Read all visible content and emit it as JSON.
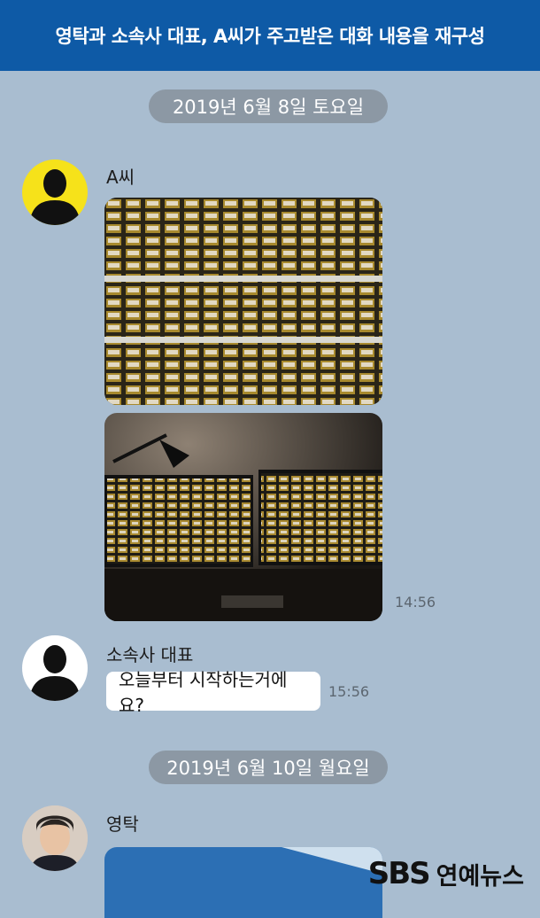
{
  "header": {
    "title": "영탁과 소속사 대표, A씨가 주고받은 대화 내용을 재구성"
  },
  "dates": [
    {
      "label": "2019년 6월 8일 토요일"
    },
    {
      "label": "2019년 6월 10일 월요일"
    }
  ],
  "messages": [
    {
      "sender": "A씨",
      "time": "14:56",
      "avatar": "silhouette-yellow"
    },
    {
      "sender": "소속사 대표",
      "text": "오늘부터 시작하는거에요?",
      "time": "15:56",
      "avatar": "silhouette-white"
    },
    {
      "sender": "영탁",
      "avatar": "profile-photo"
    }
  ],
  "watermark": {
    "brand": "SBS",
    "label": "연예뉴스"
  },
  "colors": {
    "background": "#a9bdd0",
    "header": "#0e5aa6",
    "date_pill": "#8c98a4",
    "avatar_yellow": "#f6e21a"
  }
}
